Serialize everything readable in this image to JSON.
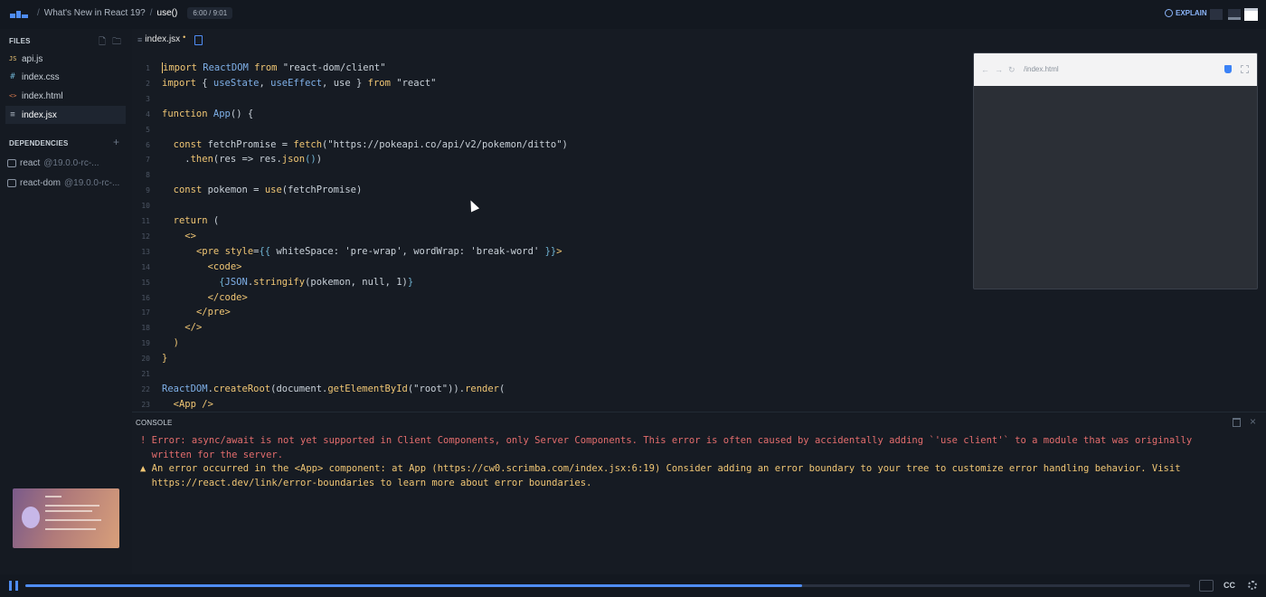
{
  "topbar": {
    "breadcrumb": [
      "What's New in React 19?",
      "use()"
    ],
    "time": "6:00 / 9:01",
    "explain_label": "EXPLAIN"
  },
  "sidebar": {
    "files_header": "FILES",
    "files": [
      {
        "icon": "JS",
        "name": "api.js",
        "color": "#f0c674"
      },
      {
        "icon": "#",
        "name": "index.css",
        "color": "#6fb3d2"
      },
      {
        "icon": "<>",
        "name": "index.html",
        "color": "#e37e4f"
      },
      {
        "icon": "≡",
        "name": "index.jsx",
        "color": "#aeb7c3"
      }
    ],
    "dependencies_header": "DEPENDENCIES",
    "dependencies": [
      {
        "name": "react",
        "version": "@19.0.0-rc-..."
      },
      {
        "name": "react-dom",
        "version": "@19.0.0-rc-..."
      }
    ]
  },
  "editor": {
    "tab_label": "index.jsx",
    "tab_modified": "•",
    "lines": [
      {
        "n": "1",
        "html": "<span class=\"cursor\"></span><span class=\"kw\">import</span> <span class=\"fn\">ReactDOM</span> <span class=\"kw\">from</span> \"react-dom/client\""
      },
      {
        "n": "2",
        "html": "<span class=\"kw\">import</span> { <span class=\"fn\">useState</span>, <span class=\"fn\">useEffect</span>, use } <span class=\"kw\">from</span> \"react\""
      },
      {
        "n": "3",
        "html": ""
      },
      {
        "n": "4",
        "html": "<span class=\"kw\">function</span> <span class=\"fn\">App</span>() {"
      },
      {
        "n": "5",
        "html": ""
      },
      {
        "n": "6",
        "html": "  <span class=\"kw\">const</span> fetchPromise = <span class=\"kw\">fetch</span>(\"https://pokeapi.co/api/v2/pokemon/ditto\")"
      },
      {
        "n": "7",
        "html": "    .<span class=\"kw\">then</span>(res => res.<span class=\"kw\">json</span><span class=\"br\">()</span>)"
      },
      {
        "n": "8",
        "html": ""
      },
      {
        "n": "9",
        "html": "  <span class=\"kw\">const</span> pokemon = <span class=\"kw\">use</span>(fetchPromise)"
      },
      {
        "n": "10",
        "html": ""
      },
      {
        "n": "11",
        "html": "  <span class=\"kw\">return</span> ("
      },
      {
        "n": "12",
        "html": "    <span class=\"kw\">&lt;&gt;</span>"
      },
      {
        "n": "13",
        "html": "      <span class=\"kw\">&lt;pre</span> <span class=\"kw\">style</span>=<span class=\"br\">{{</span> whiteSpace: 'pre-wrap', wordWrap: 'break-word' <span class=\"br\">}}</span><span class=\"kw\">&gt;</span>"
      },
      {
        "n": "14",
        "html": "        <span class=\"kw\">&lt;code&gt;</span>"
      },
      {
        "n": "15",
        "html": "          <span class=\"br\">{</span><span class=\"fn\">JSON</span>.<span class=\"kw\">stringify</span>(pokemon, null, 1)<span class=\"br\">}</span>"
      },
      {
        "n": "16",
        "html": "        <span class=\"kw\">&lt;/code&gt;</span>"
      },
      {
        "n": "17",
        "html": "      <span class=\"kw\">&lt;/pre&gt;</span>"
      },
      {
        "n": "18",
        "html": "    <span class=\"kw\">&lt;/&gt;</span>"
      },
      {
        "n": "19",
        "html": "  <span class=\"kw\">)</span>"
      },
      {
        "n": "20",
        "html": "<span class=\"kw\">}</span>"
      },
      {
        "n": "21",
        "html": ""
      },
      {
        "n": "22",
        "html": "<span class=\"fn\">ReactDOM</span>.<span class=\"kw\">createRoot</span>(document.<span class=\"kw\">getElementById</span>(\"root\")).<span class=\"kw\">render</span>("
      },
      {
        "n": "23",
        "html": "  <span class=\"kw\">&lt;App /&gt;</span>"
      }
    ]
  },
  "preview": {
    "url": "/index.html"
  },
  "console": {
    "title": "CONSOLE",
    "error_text": "! Error: async/await is not yet supported in Client Components, only Server Components. This error is often caused by accidentally adding `'use client'` to a module that was originally\n  written for the server.",
    "warning_text": "▲ An error occurred in the <App> component: at App (https://cw0.scrimba.com/index.jsx:6:19) Consider adding an error boundary to your tree to customize error handling behavior. Visit\n  https://react.dev/link/error-boundaries to learn more about error boundaries."
  },
  "player": {
    "progress_fraction": 0.667,
    "cc_label": "CC"
  }
}
